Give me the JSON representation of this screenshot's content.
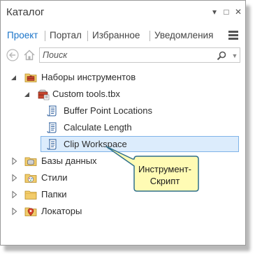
{
  "window": {
    "title": "Каталог",
    "controls": {
      "dropdown": "▾",
      "pin": "□",
      "close": "✕"
    }
  },
  "tabs": [
    {
      "label": "Проект",
      "active": true
    },
    {
      "label": "Портал",
      "active": false
    },
    {
      "label": "Избранное",
      "active": false
    },
    {
      "label": "Уведомления",
      "active": false
    }
  ],
  "search": {
    "placeholder": "Поиск",
    "value": ""
  },
  "tree": {
    "toolboxes": {
      "label": "Наборы инструментов"
    },
    "custom_tbx": {
      "label": "Custom tools.tbx"
    },
    "tool_buffer": {
      "label": "Buffer Point Locations"
    },
    "tool_calc": {
      "label": "Calculate Length"
    },
    "tool_clip": {
      "label": "Clip Workspace"
    },
    "databases": {
      "label": "Базы данных"
    },
    "styles": {
      "label": "Стили"
    },
    "folders": {
      "label": "Папки"
    },
    "locators": {
      "label": "Локаторы"
    }
  },
  "callout": {
    "line1": "Инструмент-",
    "line2": "Скрипт"
  },
  "colors": {
    "accent": "#1a74c9",
    "selection_bg": "#dcecfc",
    "selection_border": "#7fb3e8",
    "callout_fill": "#fffbb4",
    "callout_border": "#2e6f8a"
  }
}
